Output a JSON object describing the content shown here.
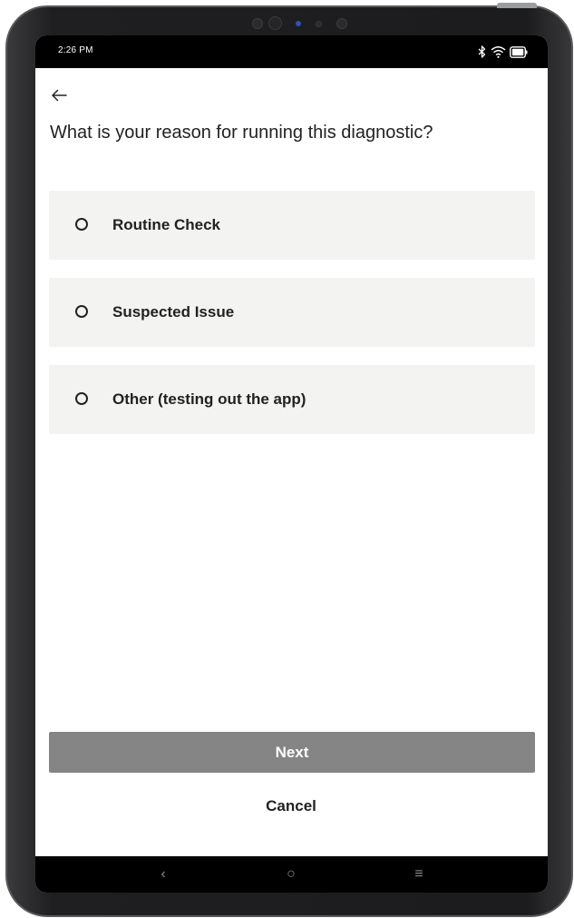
{
  "status_bar": {
    "time": "2:26 PM",
    "icons": [
      "bluetooth-icon",
      "wifi-icon",
      "battery-icon"
    ]
  },
  "header": {
    "back_icon": "arrow-left-icon"
  },
  "question": {
    "text": "What is your reason for running this diagnostic?"
  },
  "options": [
    {
      "label": "Routine Check",
      "selected": false
    },
    {
      "label": "Suspected Issue",
      "selected": false
    },
    {
      "label": "Other (testing out the app)",
      "selected": false
    }
  ],
  "actions": {
    "next_label": "Next",
    "next_enabled": false,
    "cancel_label": "Cancel"
  },
  "nav_bar": {
    "back": "‹",
    "home": "○",
    "menu": "≡"
  },
  "colors": {
    "option_bg": "#f3f3f2",
    "next_disabled_bg": "#858585",
    "text": "#222222",
    "bar_bg": "#000000"
  }
}
